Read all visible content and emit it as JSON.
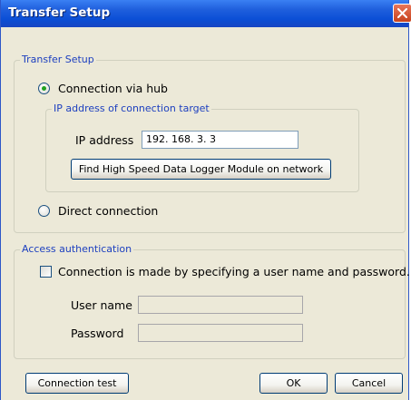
{
  "window": {
    "title": "Transfer Setup"
  },
  "transfer_setup": {
    "legend": "Transfer Setup",
    "via_hub_label": "Connection via hub",
    "ip_group": {
      "legend": "IP address of connection target",
      "ip_label": "IP address",
      "ip_value": "192. 168. 3. 3",
      "find_button": "Find High Speed Data Logger Module on network"
    },
    "direct_label": "Direct connection",
    "selected": "Connection via hub"
  },
  "access_auth": {
    "legend": "Access authentication",
    "checkbox_label": "Connection is made by specifying a user name and password.",
    "checked": false,
    "user_name_label": "User name",
    "user_name_value": "",
    "password_label": "Password",
    "password_value": ""
  },
  "buttons": {
    "connection_test": "Connection test",
    "ok": "OK",
    "cancel": "Cancel"
  },
  "colors": {
    "title_bar": "#0b4fd6",
    "group_legend": "#1c3fbf",
    "dialog_bg": "#ece9d8",
    "radio_dot": "#21a121"
  }
}
